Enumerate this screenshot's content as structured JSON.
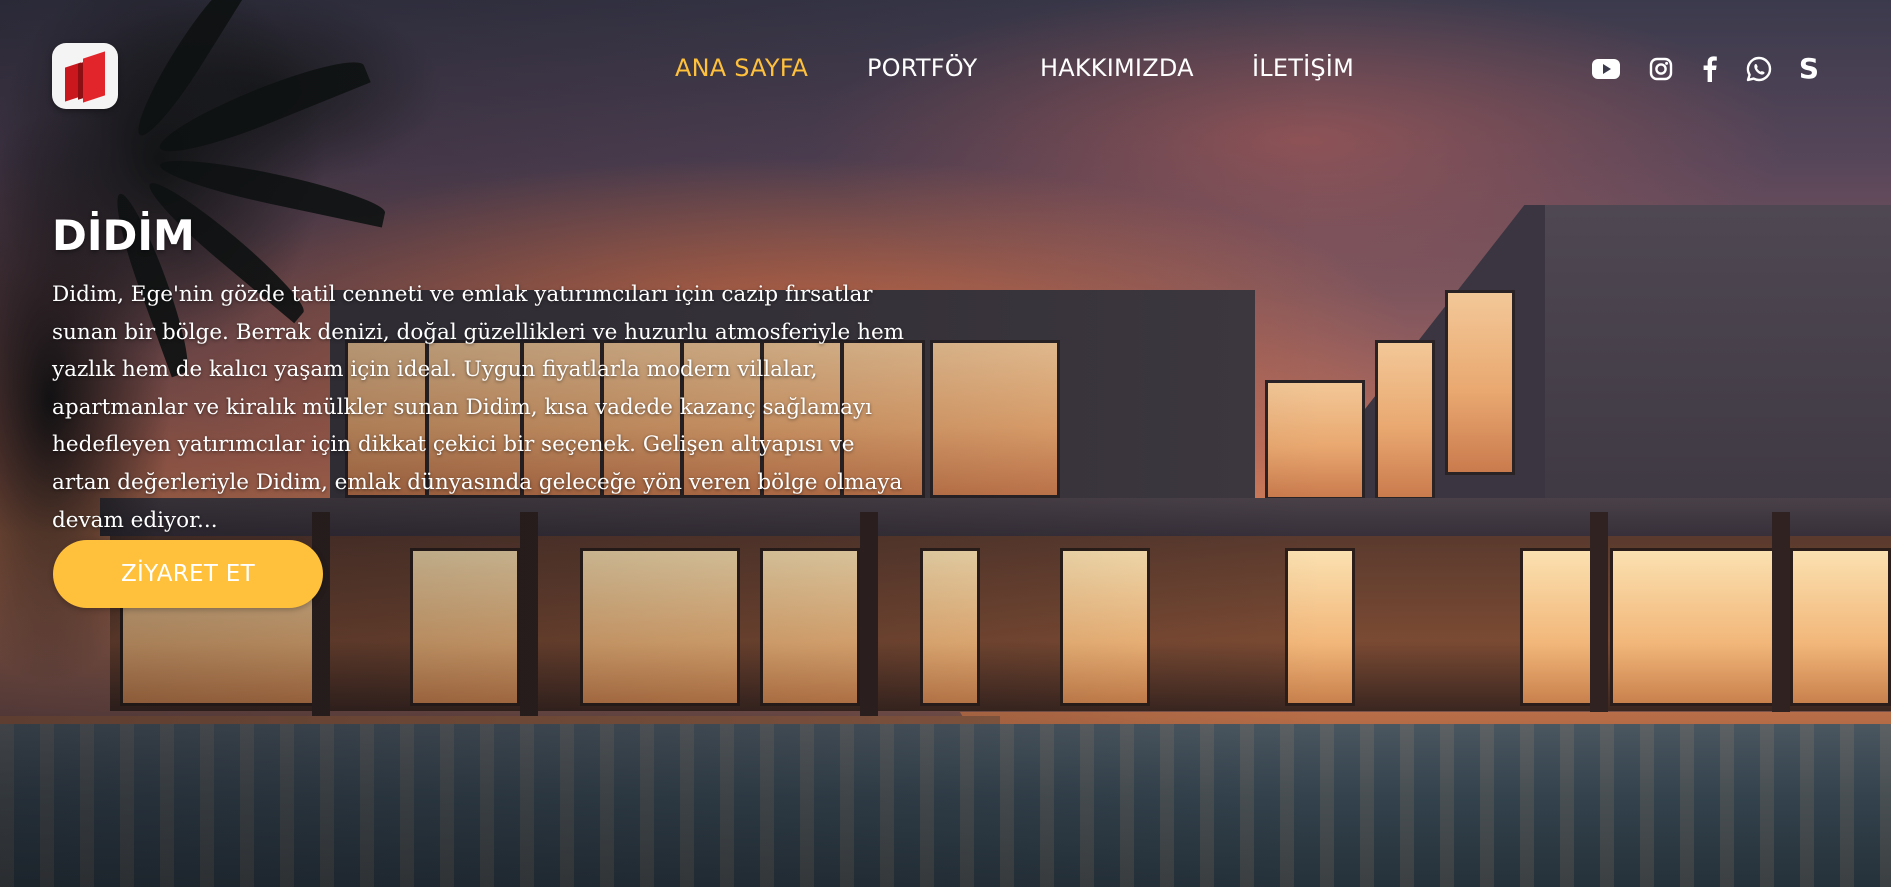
{
  "brand": {
    "logo_alt": "Company logo",
    "accent_color": "#ffc13b"
  },
  "nav": {
    "items": [
      {
        "label": "ANA SAYFA",
        "active": true
      },
      {
        "label": "PORTFÖY",
        "active": false
      },
      {
        "label": "HAKKIMIZDA",
        "active": false
      },
      {
        "label": "İLETİŞİM",
        "active": false
      }
    ]
  },
  "social": {
    "icons": [
      "youtube-icon",
      "instagram-icon",
      "facebook-icon",
      "whatsapp-icon",
      "sahibinden-icon"
    ],
    "sahibinden_letter": "S"
  },
  "hero": {
    "title": "DİDİM",
    "description": "Didim, Ege'nin gözde tatil cenneti ve emlak yatırımcıları için cazip fırsatlar sunan bir bölge. Berrak denizi, doğal güzellikleri ve huzurlu atmosferiyle hem yazlık hem de kalıcı yaşam için ideal. Uygun fiyatlarla modern villalar, apartmanlar ve kiralık mülkler sunan Didim, kısa vadede kazanç sağlamayı hedefleyen yatırımcılar için dikkat çekici bir seçenek. Gelişen altyapısı ve artan değerleriyle Didim, emlak dünyasında geleceğe yön veren bölge olmaya devam ediyor...",
    "cta_label": "ZİYARET ET"
  }
}
